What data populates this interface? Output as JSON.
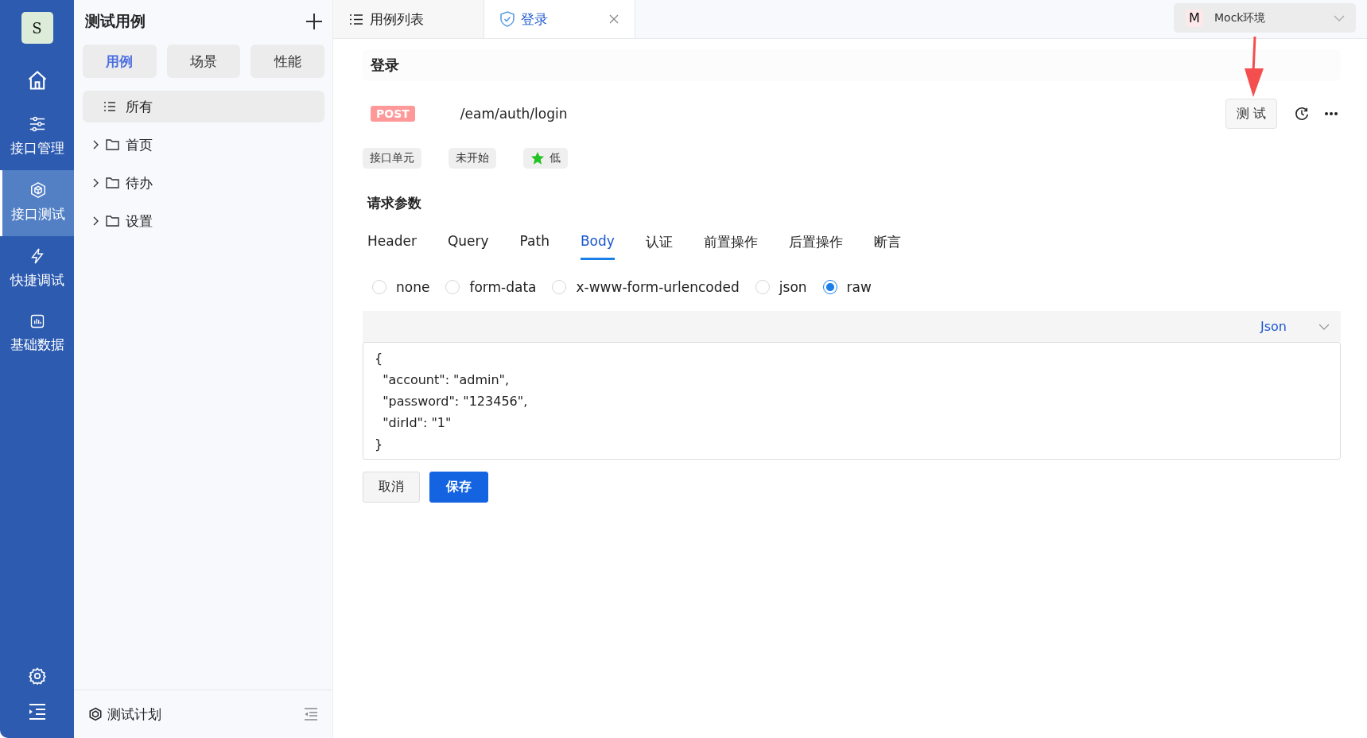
{
  "nav": {
    "avatar": "S",
    "items": [
      {
        "kind": "home",
        "selected": false
      },
      {
        "kind": "sliders",
        "label": "接口管理",
        "selected": false
      },
      {
        "kind": "cube",
        "label": "接口测试",
        "selected": true
      },
      {
        "kind": "bolt",
        "label": "快捷调试",
        "selected": false
      },
      {
        "kind": "chart",
        "label": "基础数据",
        "selected": false
      }
    ]
  },
  "sidebar": {
    "title": "测试用例",
    "segments": [
      {
        "label": "用例",
        "selected": true
      },
      {
        "label": "场景",
        "selected": false
      },
      {
        "label": "性能",
        "selected": false
      }
    ],
    "tree": [
      {
        "kind": "all",
        "label": "所有",
        "selected": true
      },
      {
        "kind": "folder",
        "label": "首页",
        "selected": false,
        "expanded": false
      },
      {
        "kind": "folder",
        "label": "待办",
        "selected": false,
        "expanded": false
      },
      {
        "kind": "folder",
        "label": "设置",
        "selected": false,
        "expanded": false
      }
    ],
    "footer": "测试计划"
  },
  "tabs": [
    {
      "kind": "list",
      "label": "用例列表",
      "selected": false,
      "closable": false
    },
    {
      "kind": "shield",
      "label": "登录",
      "selected": true,
      "closable": true
    }
  ],
  "environment": {
    "badge": "M",
    "label": "Mock环境"
  },
  "request": {
    "title": "登录",
    "method": "POST",
    "url": "/eam/auth/login",
    "test_button": "测 试",
    "tags": [
      {
        "kind": "plain",
        "label": "接口单元"
      },
      {
        "kind": "plain",
        "label": "未开始"
      },
      {
        "kind": "star",
        "label": "低"
      }
    ]
  },
  "params": {
    "title": "请求参数",
    "tabs": [
      {
        "label": "Header",
        "selected": false
      },
      {
        "label": "Query",
        "selected": false
      },
      {
        "label": "Path",
        "selected": false
      },
      {
        "label": "Body",
        "selected": true
      },
      {
        "label": "认证",
        "selected": false
      },
      {
        "label": "前置操作",
        "selected": false
      },
      {
        "label": "后置操作",
        "selected": false
      },
      {
        "label": "断言",
        "selected": false
      }
    ],
    "body_types": [
      {
        "label": "none",
        "selected": false
      },
      {
        "label": "form-data",
        "selected": false
      },
      {
        "label": "x-www-form-urlencoded",
        "selected": false
      },
      {
        "label": "json",
        "selected": false
      },
      {
        "label": "raw",
        "selected": true
      }
    ],
    "format": "Json",
    "code": [
      "{",
      "  \"account\": \"admin\",",
      "  \"password\": \"123456\",",
      "  \"dirId\": \"1\"",
      "}"
    ]
  },
  "buttons": [
    {
      "kind": "cancel",
      "label": "取消"
    },
    {
      "kind": "primary",
      "label": "保存"
    }
  ]
}
